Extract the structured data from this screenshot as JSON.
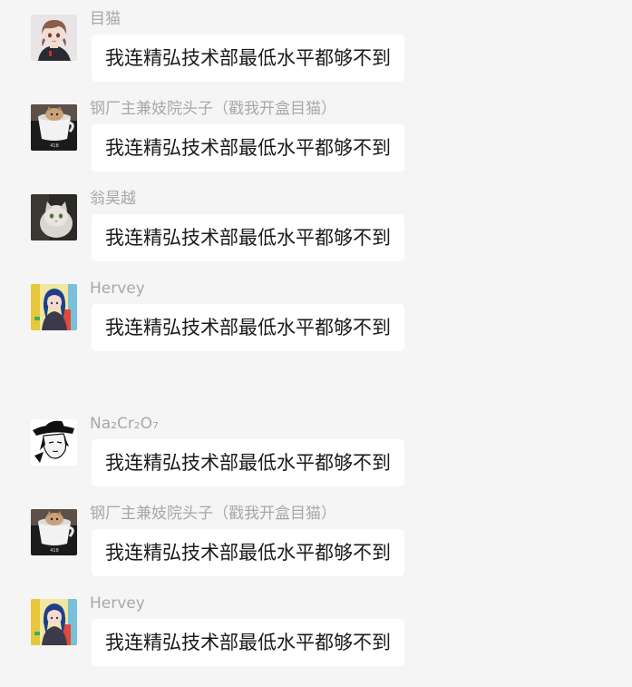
{
  "messages": [
    {
      "sender": "目猫",
      "text": "我连精弘技术部最低水平都够不到",
      "avatar": "anime-boy-avatar"
    },
    {
      "sender": "钢厂主兼妓院头子（戳我开盒目猫）",
      "text": "我连精弘技术部最低水平都够不到",
      "avatar": "cup-cat-avatar"
    },
    {
      "sender": "翁昊越",
      "text": "我连精弘技术部最低水平都够不到",
      "avatar": "white-cat-avatar"
    },
    {
      "sender": "Hervey",
      "text": "我连精弘技术部最低水平都够不到",
      "avatar": "anime-girl-avatar"
    },
    {
      "sender": "Na₂Cr₂O₇",
      "text": "我连精弘技术部最低水平都够不到",
      "avatar": "manga-hat-avatar"
    },
    {
      "sender": "钢厂主兼妓院头子（戳我开盒目猫）",
      "text": "我连精弘技术部最低水平都够不到",
      "avatar": "cup-cat-avatar"
    },
    {
      "sender": "Hervey",
      "text": "我连精弘技术部最低水平都够不到",
      "avatar": "anime-girl-avatar"
    }
  ],
  "colors": {
    "background": "#f5f5f5",
    "bubble": "#ffffff",
    "sender_name": "#a8a8a8",
    "message_text": "#1a1a1a"
  }
}
